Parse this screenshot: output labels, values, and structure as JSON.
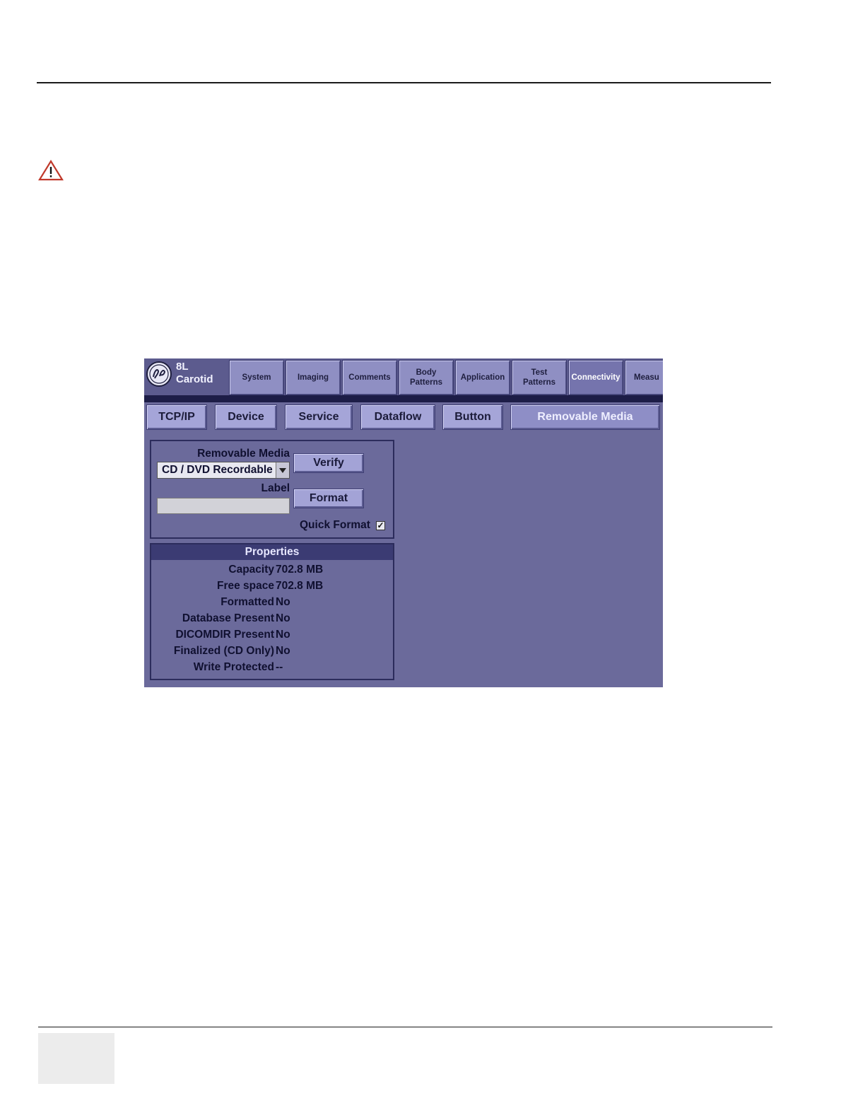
{
  "screen": {
    "probe": {
      "line1": "8L",
      "line2": "Carotid"
    },
    "tabs": [
      {
        "label": "System"
      },
      {
        "label": "Imaging"
      },
      {
        "label": "Comments"
      },
      {
        "label": "Body\nPatterns"
      },
      {
        "label": "Application"
      },
      {
        "label": "Test\nPatterns"
      },
      {
        "label": "Connectivity"
      },
      {
        "label": "Measu"
      }
    ],
    "active_tab": "Connectivity",
    "subtabs": [
      {
        "label": "TCP/IP"
      },
      {
        "label": "Device"
      },
      {
        "label": "Service"
      },
      {
        "label": "Dataflow"
      },
      {
        "label": "Button"
      },
      {
        "label": "Removable Media"
      }
    ],
    "active_subtab": "Removable Media",
    "media_panel": {
      "media_label": "Removable Media",
      "media_value": "CD / DVD Recordable",
      "label_label": "Label",
      "label_value": "",
      "verify_button": "Verify",
      "format_button": "Format",
      "quick_format_label": "Quick Format",
      "quick_format_checked": true,
      "check_glyph": "✓"
    },
    "properties": {
      "title": "Properties",
      "rows": [
        {
          "key": "Capacity",
          "value": "702.8 MB"
        },
        {
          "key": "Free space",
          "value": "702.8 MB"
        },
        {
          "key": "Formatted",
          "value": "No"
        },
        {
          "key": "Database Present",
          "value": "No"
        },
        {
          "key": "DICOMDIR Present",
          "value": "No"
        },
        {
          "key": "Finalized (CD Only)",
          "value": "No"
        },
        {
          "key": "Write Protected",
          "value": "--"
        }
      ]
    }
  },
  "colors": {
    "screen_bg": "#6b6a9b",
    "tab_bg": "#8f8fc3",
    "button_bg": "#a3a3d6",
    "warning_red": "#c0392b"
  },
  "icons": {
    "warning": "warning-triangle-icon",
    "logo": "ge-logo-icon"
  }
}
